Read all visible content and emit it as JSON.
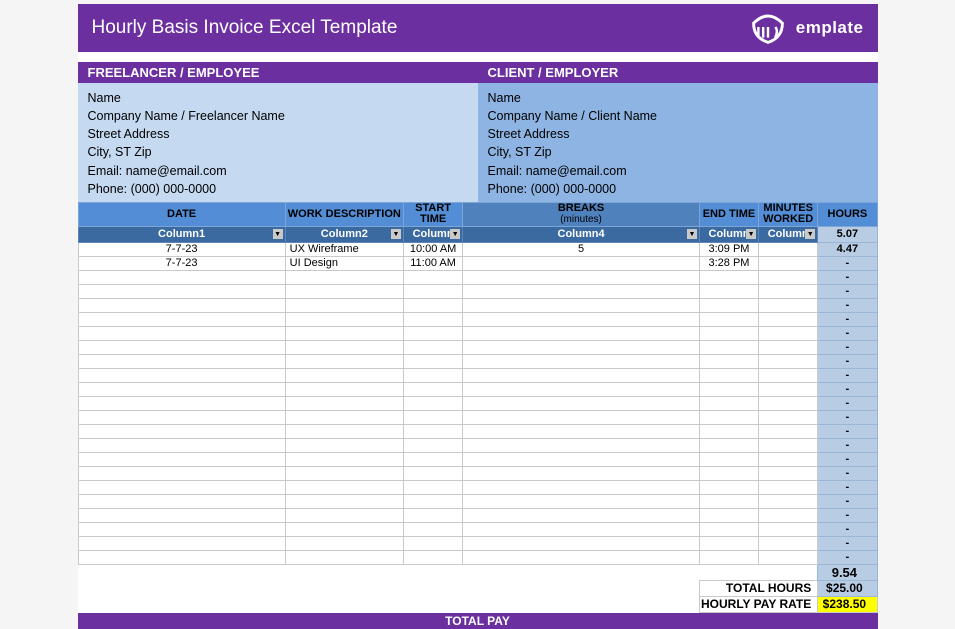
{
  "title": "Hourly Basis Invoice Excel Template",
  "logo_text": "emplate",
  "sections": {
    "freelancer_heading": "FREELANCER / EMPLOYEE",
    "client_heading": "CLIENT / EMPLOYER"
  },
  "freelancer": {
    "name": "Name",
    "company": "Company Name / Freelancer Name",
    "street": "Street Address",
    "city": "City, ST Zip",
    "email": "Email: name@email.com",
    "phone": "Phone: (000) 000-0000"
  },
  "client": {
    "name": "Name",
    "company": "Company Name / Client Name",
    "street": "Street Address",
    "city": "City, ST Zip",
    "email": "Email: name@email.com",
    "phone": "Phone: (000) 000-0000"
  },
  "headers": {
    "date": "DATE",
    "work": "WORK DESCRIPTION",
    "start": "START TIME",
    "breaks": "BREAKS",
    "breaks_sub": "(minutes)",
    "end": "END TIME",
    "minutes": "MINUTES WORKED",
    "hours": "HOURS"
  },
  "filters": {
    "c1": "Column1",
    "c2": "Column2",
    "c3": "Column",
    "c4": "Column4",
    "c5": "Column",
    "c6": "Column",
    "c7": "5.07"
  },
  "rows": [
    {
      "date": "7-7-23",
      "work": "UX Wireframe",
      "start": "10:00 AM",
      "breaks": "5",
      "end": "3:09 PM",
      "minutes": "",
      "hours": "4.47"
    },
    {
      "date": "7-7-23",
      "work": "UI Design",
      "start": "11:00 AM",
      "breaks": "",
      "end": "3:28 PM",
      "minutes": "",
      "hours": "-"
    },
    {
      "date": "",
      "work": "",
      "start": "",
      "breaks": "",
      "end": "",
      "minutes": "",
      "hours": "-"
    },
    {
      "date": "",
      "work": "",
      "start": "",
      "breaks": "",
      "end": "",
      "minutes": "",
      "hours": "-"
    },
    {
      "date": "",
      "work": "",
      "start": "",
      "breaks": "",
      "end": "",
      "minutes": "",
      "hours": "-"
    },
    {
      "date": "",
      "work": "",
      "start": "",
      "breaks": "",
      "end": "",
      "minutes": "",
      "hours": "-"
    },
    {
      "date": "",
      "work": "",
      "start": "",
      "breaks": "",
      "end": "",
      "minutes": "",
      "hours": "-"
    },
    {
      "date": "",
      "work": "",
      "start": "",
      "breaks": "",
      "end": "",
      "minutes": "",
      "hours": "-"
    },
    {
      "date": "",
      "work": "",
      "start": "",
      "breaks": "",
      "end": "",
      "minutes": "",
      "hours": "-"
    },
    {
      "date": "",
      "work": "",
      "start": "",
      "breaks": "",
      "end": "",
      "minutes": "",
      "hours": "-"
    },
    {
      "date": "",
      "work": "",
      "start": "",
      "breaks": "",
      "end": "",
      "minutes": "",
      "hours": "-"
    },
    {
      "date": "",
      "work": "",
      "start": "",
      "breaks": "",
      "end": "",
      "minutes": "",
      "hours": "-"
    },
    {
      "date": "",
      "work": "",
      "start": "",
      "breaks": "",
      "end": "",
      "minutes": "",
      "hours": "-"
    },
    {
      "date": "",
      "work": "",
      "start": "",
      "breaks": "",
      "end": "",
      "minutes": "",
      "hours": "-"
    },
    {
      "date": "",
      "work": "",
      "start": "",
      "breaks": "",
      "end": "",
      "minutes": "",
      "hours": "-"
    },
    {
      "date": "",
      "work": "",
      "start": "",
      "breaks": "",
      "end": "",
      "minutes": "",
      "hours": "-"
    },
    {
      "date": "",
      "work": "",
      "start": "",
      "breaks": "",
      "end": "",
      "minutes": "",
      "hours": "-"
    },
    {
      "date": "",
      "work": "",
      "start": "",
      "breaks": "",
      "end": "",
      "minutes": "",
      "hours": "-"
    },
    {
      "date": "",
      "work": "",
      "start": "",
      "breaks": "",
      "end": "",
      "minutes": "",
      "hours": "-"
    },
    {
      "date": "",
      "work": "",
      "start": "",
      "breaks": "",
      "end": "",
      "minutes": "",
      "hours": "-"
    },
    {
      "date": "",
      "work": "",
      "start": "",
      "breaks": "",
      "end": "",
      "minutes": "",
      "hours": "-"
    },
    {
      "date": "",
      "work": "",
      "start": "",
      "breaks": "",
      "end": "",
      "minutes": "",
      "hours": "-"
    },
    {
      "date": "",
      "work": "",
      "start": "",
      "breaks": "",
      "end": "",
      "minutes": "",
      "hours": "-"
    }
  ],
  "totals": {
    "sum_hours": "9.54",
    "total_hours_label": "TOTAL HOURS",
    "total_hours_value": "$25.00",
    "hourly_pay_rate_label": "HOURLY PAY RATE",
    "hourly_pay_rate_value": "$238.50",
    "total_pay_label": "TOTAL PAY"
  }
}
